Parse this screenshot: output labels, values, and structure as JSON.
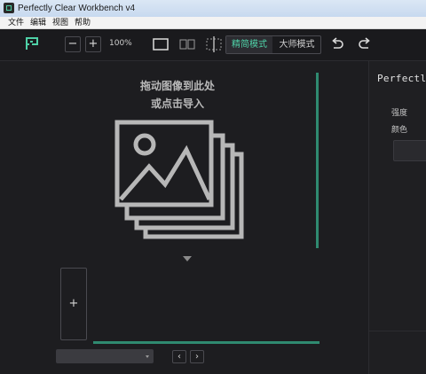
{
  "window": {
    "title": "Perfectly Clear Workbench v4"
  },
  "menu": {
    "items": [
      "文件",
      "编辑",
      "视图",
      "帮助"
    ]
  },
  "toolbar": {
    "zoom_out_label": "−",
    "zoom_in_label": "+",
    "zoom_level": "100%",
    "mode_simple": "精简模式",
    "mode_master": "大师模式",
    "active_mode": "精简模式",
    "accent_color": "#4fd1a7"
  },
  "canvas": {
    "drop_line1": "拖动图像到此处",
    "drop_line2": "或点击导入",
    "add_label": "+"
  },
  "bottom": {
    "prev_label": "‹",
    "next_label": "›",
    "preset_value": ""
  },
  "panel": {
    "title": "Perfectl",
    "strength_label": "强度",
    "color_label": "颜色"
  }
}
